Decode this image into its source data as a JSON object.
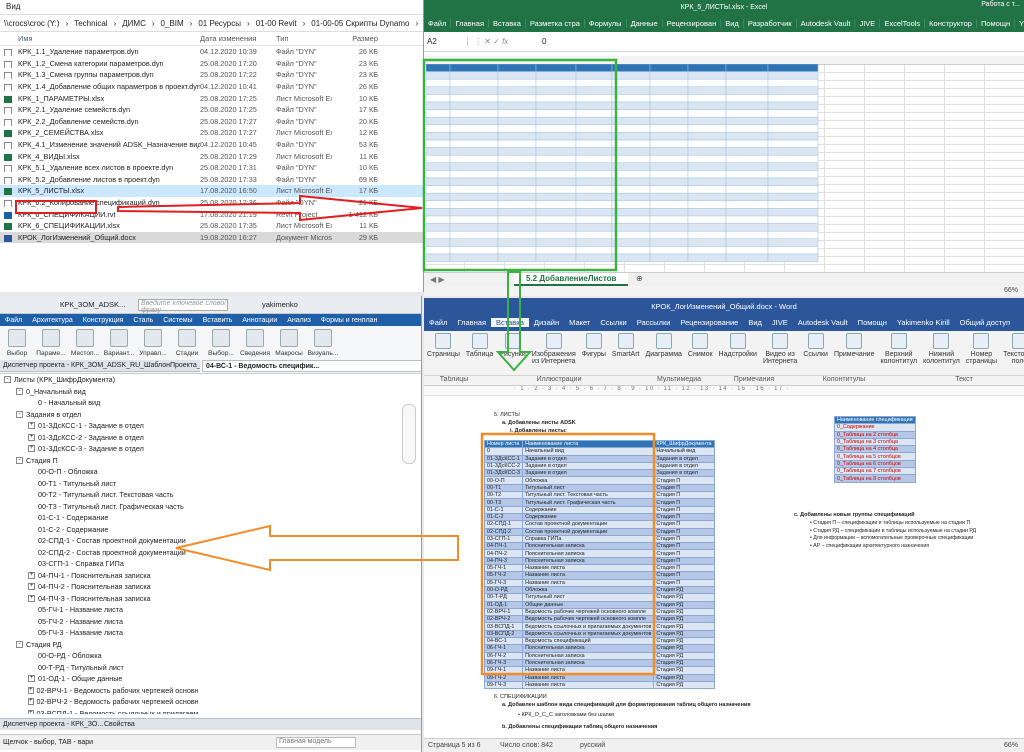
{
  "explorer": {
    "menu": "Вид",
    "address": [
      "\\\\crocs\\croc (Y:)",
      "Technical",
      "ДИМС",
      "0_BIM",
      "01 Ресурсы",
      "01-00 Revit",
      "01-00-05 Скрипты Dynamo",
      "01-00-05-00 Админские"
    ],
    "columns": {
      "name": "Имя",
      "date": "Дата изменения",
      "type": "Тип",
      "size": "Размер"
    },
    "files": [
      {
        "name": "КРК_1.1_Удаление параметров.dyn",
        "date": "04.12.2020 10:39",
        "type": "Файл \"DYN\"",
        "size": "26 КБ",
        "icon": "file-icon"
      },
      {
        "name": "КРК_1.2_Смена категории параметров.dyn",
        "date": "25.08.2020 17:20",
        "type": "Файл \"DYN\"",
        "size": "23 КБ",
        "icon": "file-icon"
      },
      {
        "name": "КРК_1.3_Смена группы параметров.dyn",
        "date": "25.08.2020 17:22",
        "type": "Файл \"DYN\"",
        "size": "23 КБ",
        "icon": "file-icon"
      },
      {
        "name": "КРК_1.4_Добавление общих параметров в проект.dyn",
        "date": "04.12.2020 10:41",
        "type": "Файл \"DYN\"",
        "size": "26 КБ",
        "icon": "file-icon"
      },
      {
        "name": "КРК_1_ПАРАМЕТРЫ.xlsx",
        "date": "25.08.2020 17:25",
        "type": "Лист Microsoft Ex...",
        "size": "10 КБ",
        "icon": "excel-icon"
      },
      {
        "name": "КРК_2.1_Удаление семейств.dyn",
        "date": "25.08.2020 17:25",
        "type": "Файл \"DYN\"",
        "size": "17 КБ",
        "icon": "file-icon"
      },
      {
        "name": "КРК_2.2_Добавление семейств.dyn",
        "date": "25.08.2020 17:27",
        "type": "Файл \"DYN\"",
        "size": "20 КБ",
        "icon": "file-icon"
      },
      {
        "name": "КРК_2_СЕМЕЙСТВА.xlsx",
        "date": "25.08.2020 17:27",
        "type": "Лист Microsoft Ex...",
        "size": "12 КБ",
        "icon": "excel-icon"
      },
      {
        "name": "КРК_4.1_Изменение значений ADSK_Назначение вида.dyn",
        "date": "04.12.2020 10:45",
        "type": "Файл \"DYN\"",
        "size": "53 КБ",
        "icon": "file-icon"
      },
      {
        "name": "КРК_4_ВИДЫ.xlsx",
        "date": "25.08.2020 17:29",
        "type": "Лист Microsoft Ex...",
        "size": "11 КБ",
        "icon": "excel-icon"
      },
      {
        "name": "КРК_5.1_Удаление всех листов в проекте.dyn",
        "date": "25.08.2020 17:31",
        "type": "Файл \"DYN\"",
        "size": "10 КБ",
        "icon": "file-icon"
      },
      {
        "name": "КРК_5.2_Добавление листов в проект.dyn",
        "date": "25.08.2020 17:33",
        "type": "Файл \"DYN\"",
        "size": "69 КБ",
        "icon": "file-icon"
      },
      {
        "name": "КРК_5_ЛИСТЫ.xlsx",
        "date": "17.08.2020 16:50",
        "type": "Лист Microsoft Ex...",
        "size": "17 КБ",
        "icon": "excel-icon"
      },
      {
        "name": "КРК_6.2_Копирование спецификаций.dyn",
        "date": "25.08.2020 17:36",
        "type": "Файл \"DYN\"",
        "size": "21 КБ",
        "icon": "file-icon"
      },
      {
        "name": "КРК_6_СПЕЦИФИКАЦИИ.rvt",
        "date": "17.08.2020 21:19",
        "type": "Revit Project",
        "size": "1 412 КБ",
        "icon": "revit-icon"
      },
      {
        "name": "КРК_6_СПЕЦИФИКАЦИИ.xlsx",
        "date": "25.08.2020 17:35",
        "type": "Лист Microsoft Ex...",
        "size": "11 КБ",
        "icon": "excel-icon"
      },
      {
        "name": "КРОК_ЛогИзменений_Общий.docx",
        "date": "19.08.2020 16:27",
        "type": "Документ Micros...",
        "size": "29 КБ",
        "icon": "word-icon"
      }
    ]
  },
  "excel": {
    "title": "КРК_5_ЛИСТЫ.xlsx - Excel",
    "title_right": "Работа с т...",
    "tabs": [
      "Файл",
      "Главная",
      "Вставка",
      "Разметка стра",
      "Формулы",
      "Данные",
      "Рецензирован",
      "Вид",
      "Разработчик",
      "Autodesk Vault",
      "JIVE",
      "ExcelTools",
      "Конструктор"
    ],
    "help": "Помощн",
    "user": "Yakimenk...",
    "share": "Общий доступ",
    "cell_ref": "A2",
    "formula": "0",
    "sheet_tab": "5.2 ДобавлениеЛистов",
    "zoom": "66%"
  },
  "revit": {
    "title": "КРК_ЗОМ_ADSK...",
    "search_placeholder": "Введите ключевое слово/фразу",
    "user": "yakimenko",
    "tabs": [
      "Файл",
      "Архитектура",
      "Конструкция",
      "Сталь",
      "Системы",
      "Вставить",
      "Аннотации",
      "Анализ",
      "Формы и генплан"
    ],
    "ribbon": [
      "Выбор",
      "Параме...",
      "Местоп...",
      "Вариант...",
      "Управл...",
      "Стадии",
      "Выбор...",
      "Сведения",
      "Макросы",
      "Визуаль..."
    ],
    "browser_title": "Диспетчер проекта - КРК_ЗОМ_ADSK_RU_ШаблонПроекта_Э...",
    "view_tab": "04-ВС-1 - Ведомость специфик...",
    "tree": [
      {
        "text": "Листы (КРК_ШифрДокумента)",
        "level": 0,
        "toggle": "-"
      },
      {
        "text": "0_Начальный вид",
        "level": 1,
        "toggle": "-"
      },
      {
        "text": "0 - Начальный вид",
        "level": 2,
        "toggle": ""
      },
      {
        "text": "Задания в отдел",
        "level": 1,
        "toggle": "-"
      },
      {
        "text": "01-ЗДсКСС-1 - Задание в отдел",
        "level": 2,
        "toggle": "+"
      },
      {
        "text": "01-ЗДсКСС-2 - Задание в отдел",
        "level": 2,
        "toggle": "+"
      },
      {
        "text": "01-ЗДсКСС-3 - Задание в отдел",
        "level": 2,
        "toggle": "+"
      },
      {
        "text": "Стадия П",
        "level": 1,
        "toggle": "-"
      },
      {
        "text": "00-О-П - Обложка",
        "level": 2,
        "toggle": ""
      },
      {
        "text": "00-Т1 - Титульный лист",
        "level": 2,
        "toggle": ""
      },
      {
        "text": "00-Т2 - Титульный лист. Текстовая часть",
        "level": 2,
        "toggle": ""
      },
      {
        "text": "00-Т3 - Титульный лист. Графическая часть",
        "level": 2,
        "toggle": ""
      },
      {
        "text": "01-С-1 - Содержание",
        "level": 2,
        "toggle": ""
      },
      {
        "text": "01-С-2 - Содержание",
        "level": 2,
        "toggle": ""
      },
      {
        "text": "02-СПД-1 - Состав проектной документации",
        "level": 2,
        "toggle": ""
      },
      {
        "text": "02-СПД-2 - Состав проектной документации",
        "level": 2,
        "toggle": ""
      },
      {
        "text": "03-СГП-1 - Справка ГИПа",
        "level": 2,
        "toggle": ""
      },
      {
        "text": "04-ПЧ-1 - Пояснительная записка",
        "level": 2,
        "toggle": "+"
      },
      {
        "text": "04-ПЧ-2 - Пояснительная записка",
        "level": 2,
        "toggle": "+"
      },
      {
        "text": "04-ПЧ-3 - Пояснительная записка",
        "level": 2,
        "toggle": "+"
      },
      {
        "text": "05-ГЧ-1 - Название листа",
        "level": 2,
        "toggle": ""
      },
      {
        "text": "05-ГЧ-2 - Название листа",
        "level": 2,
        "toggle": ""
      },
      {
        "text": "05-ГЧ-3 - Название листа",
        "level": 2,
        "toggle": ""
      },
      {
        "text": "Стадия РД",
        "level": 1,
        "toggle": "-"
      },
      {
        "text": "00-О-РД - Обложка",
        "level": 2,
        "toggle": ""
      },
      {
        "text": "00-Т-РД - Титульный лист",
        "level": 2,
        "toggle": ""
      },
      {
        "text": "01-ОД-1 - Общие данные",
        "level": 2,
        "toggle": "+"
      },
      {
        "text": "02-ВРЧ-1 - Ведомость рабочих чертежей основног",
        "level": 2,
        "toggle": "+"
      },
      {
        "text": "02-ВРЧ-2 - Ведомость рабочих чертежей основног",
        "level": 2,
        "toggle": "+"
      },
      {
        "text": "03-ВСПД-1 - Ведомость ссылочных и прилагаемы",
        "level": 2,
        "toggle": "+"
      },
      {
        "text": "03-ВСПД-2 - Ведомость ссылочных и прилагаемы",
        "level": 2,
        "toggle": "+"
      },
      {
        "text": "04-ВС-1 - Ведомость спецификаций",
        "level": 2,
        "toggle": "+",
        "bold": true
      }
    ],
    "browser_tab_a": "Диспетчер проекта - КРК_ЗО...",
    "browser_tab_b": "Свойства",
    "status": "Щелчок - выбор, TAB - вари",
    "model": "Главная модель"
  },
  "word": {
    "title": "КРОК_ЛогИзменений_Общий.docx - Word",
    "tabs": [
      "Файл",
      "Главная",
      "Вставка",
      "Дизайн",
      "Макет",
      "Ссылки",
      "Рассылки",
      "Рецензирование",
      "Вид",
      "JIVE",
      "Autodesk Vault"
    ],
    "help": "Помощн",
    "user": "Yakimenko Kirill",
    "share": "Общий доступ",
    "ribbon": [
      "Страницы",
      "Таблица",
      "Рисунки",
      "Изображения из Интернета",
      "Фигуры",
      "SmartArt",
      "Диаграмма",
      "Снимок",
      "Надстройки",
      "Видео из Интернета",
      "Ссылки",
      "Примечание",
      "Верхний колонтитул",
      "Нижний колонтитул",
      "Номер страницы",
      "Текстовое поле",
      "Символы"
    ],
    "groups": [
      "Таблицы",
      "Иллюстрации",
      "Мультимедиа",
      "Примечания",
      "Колонтитулы",
      "Текст"
    ],
    "doc": {
      "item5": "5.   ЛИСТЫ",
      "item5a": "a.   Добавлены листы ADSK",
      "item5a1": "i.   Добавлены листы:",
      "table_head": [
        "Номер листа",
        "Наименование листа",
        "КРК_ШифрДокумента"
      ],
      "rows": [
        [
          "0",
          "Начальный вид",
          "Начальный вид"
        ],
        [
          "01-ЗДсКСС-1",
          "Задание в отдел",
          "Задания в отдел"
        ],
        [
          "01-ЗДсКСС-2",
          "Задание в отдел",
          "Задания в отдел"
        ],
        [
          "01-ЗДсКСС-3",
          "Задание в отдел",
          "Задания в отдел"
        ],
        [
          "00-О-П",
          "Обложка",
          "Стадия П"
        ],
        [
          "00-Т1",
          "Титульный лист",
          "Стадия П"
        ],
        [
          "00-Т2",
          "Титульный лист. Текстовая часть",
          "Стадия П"
        ],
        [
          "00-Т3",
          "Титульный лист. Графическая часть",
          "Стадия П"
        ],
        [
          "01-С-1",
          "Содержание",
          "Стадия П"
        ],
        [
          "01-С-2",
          "Содержание",
          "Стадия П"
        ],
        [
          "02-СПД-1",
          "Состав проектной документации",
          "Стадия П"
        ],
        [
          "02-СПД-2",
          "Состав проектной документации",
          "Стадия П"
        ],
        [
          "03-СГП-1",
          "Справка ГИПа",
          "Стадия П"
        ],
        [
          "04-ПЧ-1",
          "Пояснительная записка",
          "Стадия П"
        ],
        [
          "04-ПЧ-2",
          "Пояснительная записка",
          "Стадия П"
        ],
        [
          "04-ПЧ-3",
          "Пояснительная записка",
          "Стадия П"
        ],
        [
          "05-ГЧ-1",
          "Название листа",
          "Стадия П"
        ],
        [
          "05-ГЧ-2",
          "Название листа",
          "Стадия П"
        ],
        [
          "05-ГЧ-3",
          "Название листа",
          "Стадия П"
        ],
        [
          "00-О-РД",
          "Обложка",
          "Стадия РД"
        ],
        [
          "00-Т-РД",
          "Титульный лист",
          "Стадия РД"
        ],
        [
          "01-ОД-1",
          "Общие данные",
          "Стадия РД"
        ],
        [
          "02-ВРЧ-1",
          "Ведомость рабочих чертежей основного компле",
          "Стадия РД"
        ],
        [
          "02-ВРЧ-2",
          "Ведомость рабочих чертежей основного компле",
          "Стадия РД"
        ],
        [
          "03-ВСПД-1",
          "Ведомость ссылочных и прилагаемых документов",
          "Стадия РД"
        ],
        [
          "03-ВСПД-2",
          "Ведомость ссылочных и прилагаемых документов",
          "Стадия РД"
        ],
        [
          "04-ВС-1",
          "Ведомость спецификаций",
          "Стадия РД"
        ],
        [
          "06-ГЧ-1",
          "Пояснительная записка",
          "Стадия РД"
        ],
        [
          "06-ГЧ-2",
          "Пояснительная записка",
          "Стадия РД"
        ],
        [
          "06-ГЧ-3",
          "Пояснительная записка",
          "Стадия РД"
        ],
        [
          "09-ГЧ-1",
          "Название листа",
          "Стадия РД"
        ],
        [
          "09-ГЧ-2",
          "Название листа",
          "Стадия РД"
        ],
        [
          "09-ГЧ-3",
          "Название листа",
          "Стадия РД"
        ]
      ],
      "side_head": "Наименование спецификации",
      "side_rows": [
        "0_Содержание",
        "0_Таблица на 2 столбца",
        "0_Таблица на 3 столбца",
        "0_Таблица на 4 столбца",
        "0_Таблица на 5 столбцов",
        "0_Таблица на 6 столбцов",
        "0_Таблица на 7 столбцов",
        "0_Таблица на 8 столбцов"
      ],
      "c_title": "c.   Добавлены новые группы спецификаций",
      "c_items": [
        "Стадия П – спецификации и таблицы используемые на стадии П",
        "Стадия РД – спецификации и таблицы используемые на стадии РД",
        "Для информации – вспомогательные проверочные спецификации",
        "АР – спецификации архитектурного назначения"
      ],
      "item6": "6.   СПЕЦИФИКАЦИИ",
      "item6a": "a.   Добавлен шаблон вида спецификаций для форматирования таблиц общего назначения",
      "item6a1": "•   КРК_О_С_С заголовками без шапки",
      "item6b": "b.   Добавлены спецификации таблиц общего назначения"
    },
    "status_page": "Страница 5 из 6",
    "status_words": "Число слов: 842",
    "status_lang": "русский",
    "zoom": "66%"
  },
  "colors": {
    "excel": "#217346",
    "word": "#2b579a",
    "revit": "#1f5fa8",
    "red_arrow": "#e02020",
    "green_box": "#3cb043",
    "orange_box": "#f28c28"
  }
}
